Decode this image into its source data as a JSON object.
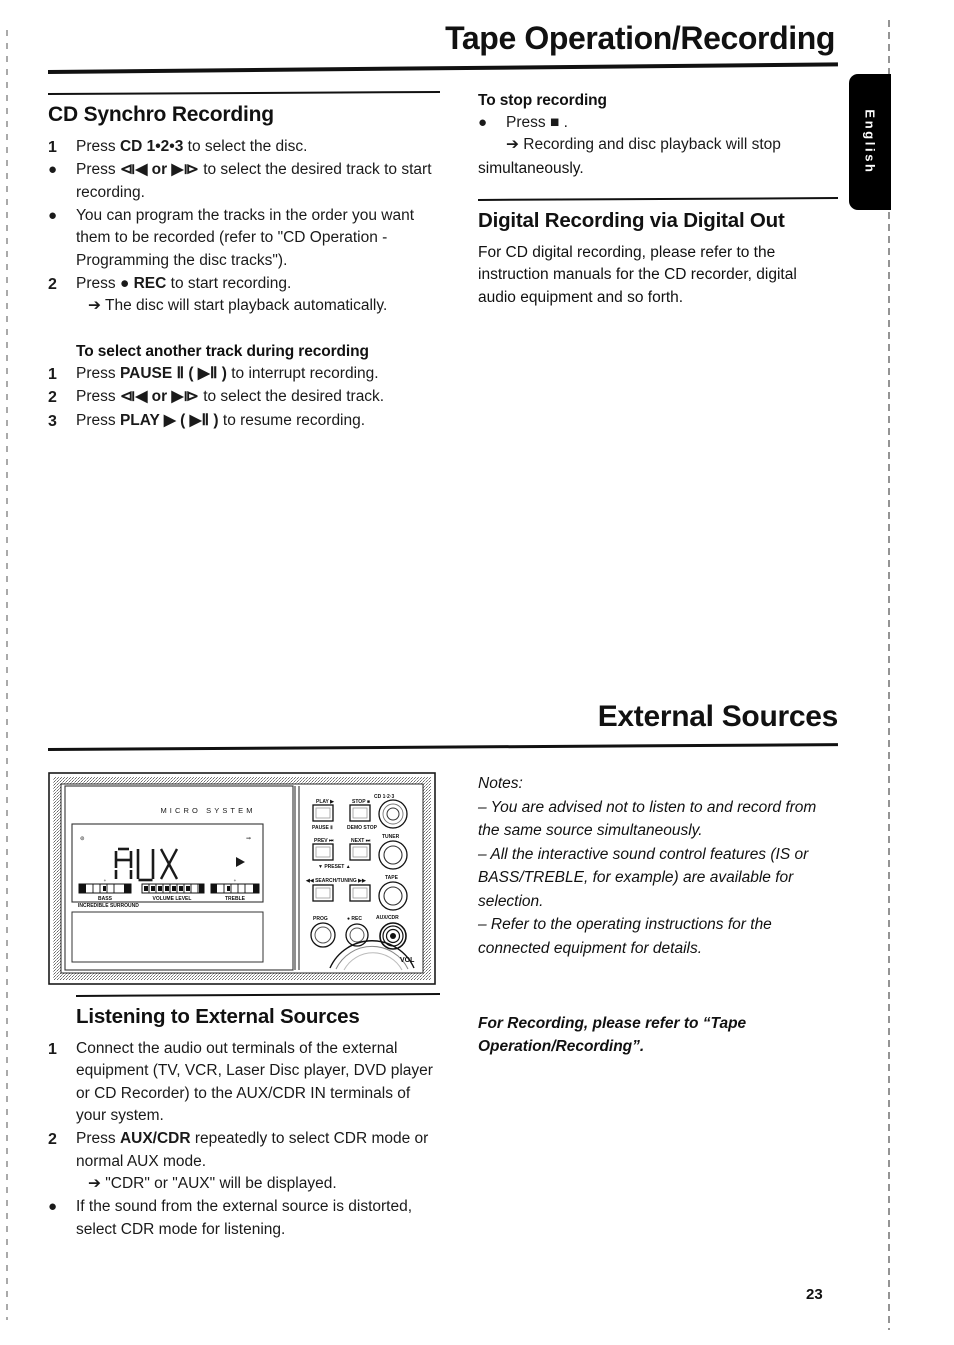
{
  "page": {
    "title": "Tape Operation/Recording",
    "section_title": "External Sources",
    "language_tab": "English",
    "number": "23"
  },
  "left_column": {
    "cd_synchro": {
      "heading": "CD Synchro Recording",
      "steps": [
        {
          "marker": "1",
          "text_before": "Press ",
          "keyword": "CD 1•2•3",
          "text_after": " to select the disc."
        },
        {
          "marker": "●",
          "text_before": "Press ",
          "keyword": "⧏◀  or  ▶⧐",
          "text_after": " to select the desired track to start recording."
        },
        {
          "marker": "●",
          "text_before": "",
          "keyword": "",
          "text_after": "You can program the tracks in the order you want them to be recorded (refer to \"CD Operation - Programming the disc tracks\")."
        },
        {
          "marker": "2",
          "text_before": "Press ",
          "keyword": "● REC",
          "text_after": " to start recording."
        }
      ],
      "arrow_note": "➔ The disc will start playback automatically."
    },
    "select_track": {
      "heading": "To select another track during recording",
      "steps": [
        {
          "marker": "1",
          "text_before": "Press ",
          "keyword": "PAUSE Ⅱ ( ▶Ⅱ )",
          "text_after": " to interrupt recording."
        },
        {
          "marker": "2",
          "text_before": "Press ",
          "keyword": "⧏◀  or  ▶⧐",
          "text_after": " to select the desired track."
        },
        {
          "marker": "3",
          "text_before": "Press ",
          "keyword": "PLAY ▶ ( ▶Ⅱ )",
          "text_after": " to resume recording."
        }
      ]
    },
    "listening": {
      "heading": "Listening to External Sources",
      "steps": [
        {
          "marker": "1",
          "text_before": "",
          "keyword": "",
          "text_after": "Connect the audio out terminals of the external equipment (TV, VCR, Laser Disc player, DVD player or CD Recorder) to the AUX/CDR IN terminals of your system."
        },
        {
          "marker": "2",
          "text_before": "Press ",
          "keyword": "AUX/CDR",
          "text_after": " repeatedly to select CDR mode or normal AUX mode."
        }
      ],
      "arrow_note": "➔ \"CDR\" or \"AUX\" will be displayed.",
      "bullet_note": {
        "marker": "●",
        "text": "If the sound from the external source is distorted, select CDR mode for listening."
      }
    }
  },
  "right_column": {
    "stop_recording": {
      "heading": "To stop recording",
      "steps": [
        {
          "marker": "●",
          "text_before": "Press ",
          "keyword": "■",
          "text_after": " ."
        }
      ],
      "arrow_note": "➔ Recording and disc playback will stop",
      "arrow_note_cont": "simultaneously."
    },
    "digital_recording": {
      "heading": "Digital Recording via Digital Out",
      "body": "For CD digital recording, please refer to the instruction manuals for the CD recorder, digital audio equipment and so forth."
    },
    "notes": {
      "label": "Notes:",
      "items": [
        "–  You are advised not to listen to and record from the same source simultaneously.",
        "–  All the interactive sound control features (IS or BASS/TREBLE, for example) are available for selection.",
        "–  Refer to the operating instructions for the connected equipment for details."
      ]
    },
    "recording_note": "For Recording, please refer to “Tape Operation/Recording”."
  },
  "illustration": {
    "alt": "micro system front panel",
    "brand_text": "MICRO SYSTEM",
    "display_text": "AUX",
    "display_indicators": [
      "BASS",
      "VOLUME  LEVEL",
      "TREBLE",
      "INCREDIBLE SURROUND"
    ],
    "buttons": [
      {
        "label": "PLAY ▶",
        "sub": "PAUSE Ⅱ"
      },
      {
        "label": "STOP ■",
        "sub": "DEMO STOP"
      },
      {
        "label": "PREV ⧏◀",
        "sub": "▼ PRESET ▲"
      },
      {
        "label": "NEXT ▶⧐",
        "sub": ""
      },
      {
        "label": "◀◀ SEARCH/TUNING ▶▶",
        "sub": ""
      }
    ],
    "knobs": [
      "CD 1•2•3",
      "TUNER",
      "TAPE",
      "PROG",
      "● REC",
      "AUX/CDR",
      "VOL"
    ]
  }
}
